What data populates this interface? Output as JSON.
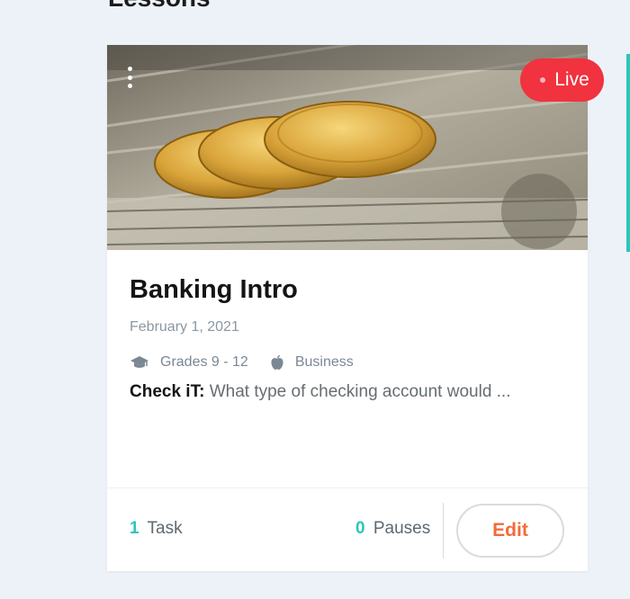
{
  "section": {
    "title": "Lessons"
  },
  "lesson_card": {
    "status": "Live",
    "title": "Banking Intro",
    "date": "February 1, 2021",
    "grades": "Grades 9 - 12",
    "subject": "Business",
    "description_label": "Check iT:",
    "description_text": "What type of checking account would ...",
    "task_count": "1",
    "task_label": "Task",
    "pause_count": "0",
    "pause_label": "Pauses",
    "edit_label": "Edit",
    "grades_icon": "graduation-cap-icon",
    "subject_icon": "apple-icon"
  },
  "colors": {
    "accent_teal": "#2bc6b8",
    "live_red": "#f1323f",
    "edit_orange": "#f26b3a",
    "page_bg": "#edf2f9"
  }
}
